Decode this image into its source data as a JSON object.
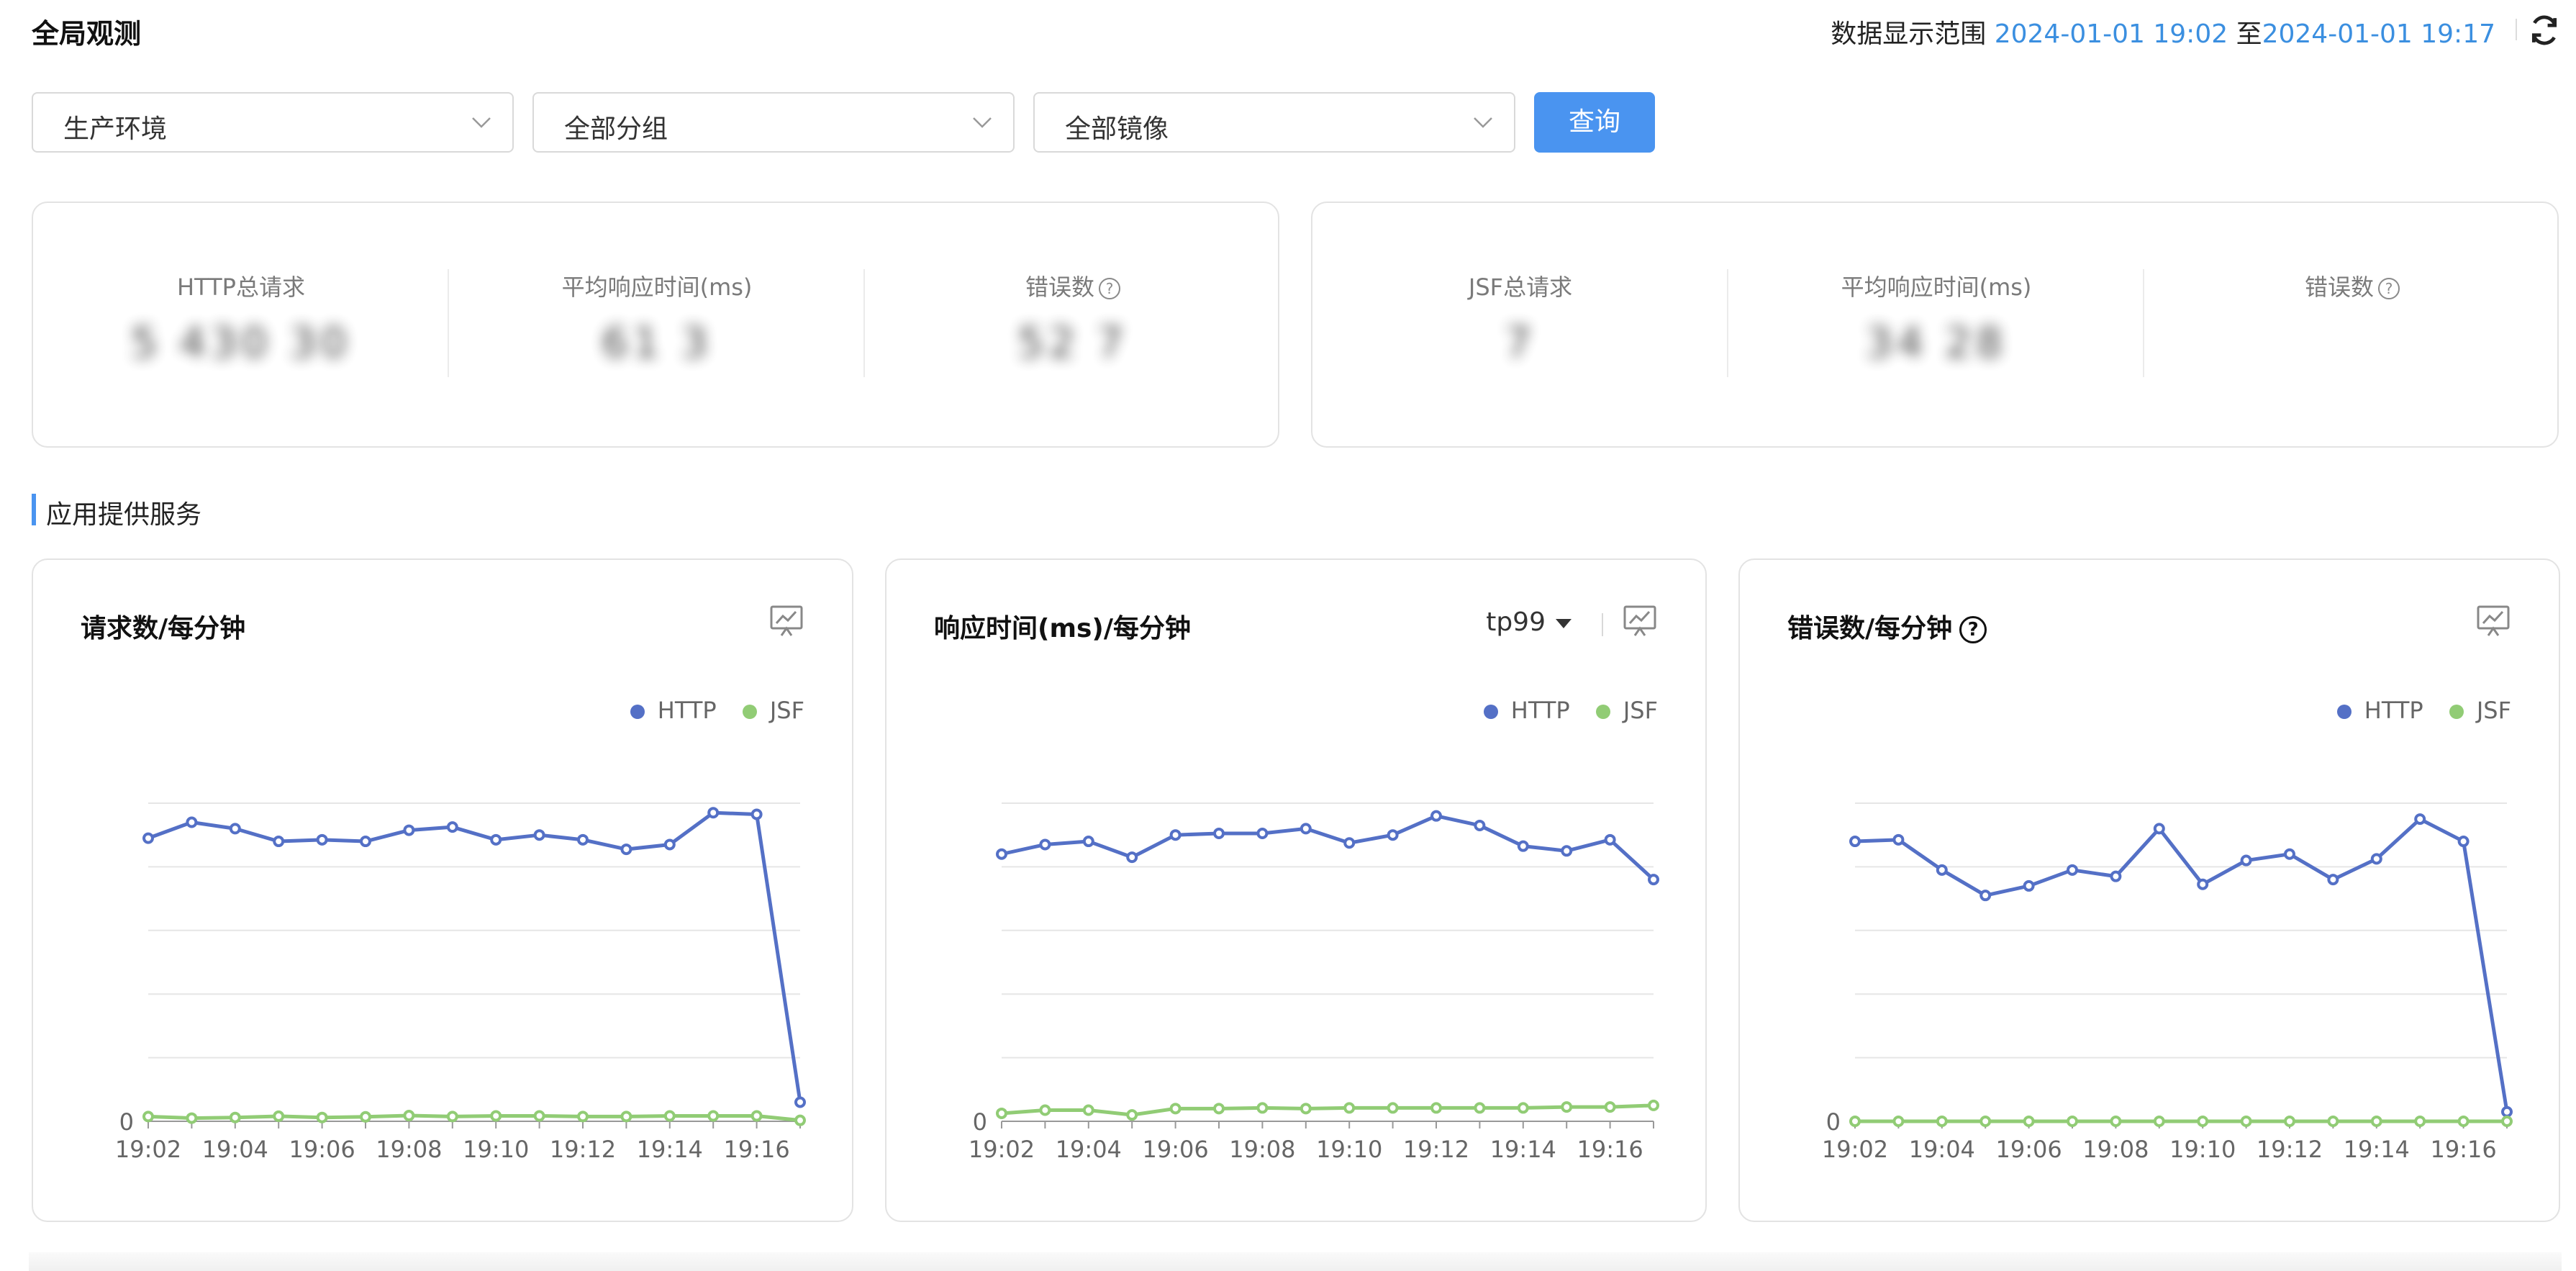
{
  "header": {
    "title": "全局观测",
    "range_label": "数据显示范围",
    "range_start": "2024-01-01 19:02",
    "range_to": "至",
    "range_end": "2024-01-01 19:17"
  },
  "filters": {
    "environment": "生产环境",
    "group": "全部分组",
    "image": "全部镜像",
    "query_label": "查询"
  },
  "summary_http": {
    "items": [
      {
        "label": "HTTP总请求",
        "value": "5 430 30"
      },
      {
        "label": "平均响应时间(ms)",
        "value": "61      3"
      },
      {
        "label": "错误数",
        "value": "52 7"
      }
    ]
  },
  "summary_jsf": {
    "items": [
      {
        "label": "JSF总请求",
        "value": "7   "
      },
      {
        "label": "平均响应时间(ms)",
        "value": "  34 28"
      },
      {
        "label": "错误数",
        "value": "  "
      }
    ]
  },
  "section": {
    "title": "应用提供服务"
  },
  "colors": {
    "http": "#5470c6",
    "jsf": "#91cc75",
    "accent": "#4a94f0"
  },
  "charts": [
    {
      "title": "请求数/每分钟",
      "legend": [
        "HTTP",
        "JSF"
      ],
      "chart_data": {
        "type": "line",
        "x": [
          "19:02",
          "19:03",
          "19:04",
          "19:05",
          "19:06",
          "19:07",
          "19:08",
          "19:09",
          "19:10",
          "19:11",
          "19:12",
          "19:13",
          "19:14",
          "19:15",
          "19:16",
          "19:17"
        ],
        "x_tick_labels": [
          "19:02",
          "19:04",
          "19:06",
          "19:08",
          "19:10",
          "19:12",
          "19:14",
          "19:16"
        ],
        "y_tick_labels": [
          "0"
        ],
        "ylim": [
          0,
          100
        ],
        "series": [
          {
            "name": "HTTP",
            "values": [
              89,
              94,
              92,
              88,
              88.5,
              88,
              91.5,
              92.5,
              88.5,
              90,
              88.5,
              85.5,
              87,
              97,
              96.5,
              6
            ]
          },
          {
            "name": "JSF",
            "values": [
              1.5,
              1,
              1.2,
              1.6,
              1.2,
              1.4,
              1.8,
              1.5,
              1.7,
              1.7,
              1.5,
              1.5,
              1.7,
              1.7,
              1.7,
              0.3
            ]
          }
        ]
      }
    },
    {
      "title": "响应时间(ms)/每分钟",
      "percentile": "tp99",
      "legend": [
        "HTTP",
        "JSF"
      ],
      "chart_data": {
        "type": "line",
        "x": [
          "19:02",
          "19:03",
          "19:04",
          "19:05",
          "19:06",
          "19:07",
          "19:08",
          "19:09",
          "19:10",
          "19:11",
          "19:12",
          "19:13",
          "19:14",
          "19:15",
          "19:16",
          "19:17"
        ],
        "x_tick_labels": [
          "19:02",
          "19:04",
          "19:06",
          "19:08",
          "19:10",
          "19:12",
          "19:14",
          "19:16"
        ],
        "y_tick_labels": [
          "0"
        ],
        "ylim": [
          0,
          100
        ],
        "series": [
          {
            "name": "HTTP",
            "values": [
              84,
              87,
              88,
              83,
              90,
              90.5,
              90.5,
              92,
              87.5,
              90,
              96,
              93,
              86.5,
              85,
              88.5,
              76
            ]
          },
          {
            "name": "JSF",
            "values": [
              2.5,
              3.5,
              3.5,
              2,
              4,
              4,
              4.2,
              4,
              4.2,
              4.2,
              4.2,
              4.2,
              4.2,
              4.5,
              4.5,
              5
            ]
          }
        ]
      }
    },
    {
      "title": "错误数/每分钟",
      "legend": [
        "HTTP",
        "JSF"
      ],
      "chart_data": {
        "type": "line",
        "x": [
          "19:02",
          "19:03",
          "19:04",
          "19:05",
          "19:06",
          "19:07",
          "19:08",
          "19:09",
          "19:10",
          "19:11",
          "19:12",
          "19:13",
          "19:14",
          "19:15",
          "19:16",
          "19:17"
        ],
        "x_tick_labels": [
          "19:02",
          "19:04",
          "19:06",
          "19:08",
          "19:10",
          "19:12",
          "19:14",
          "19:16"
        ],
        "y_tick_labels": [
          "0"
        ],
        "ylim": [
          0,
          100
        ],
        "series": [
          {
            "name": "HTTP",
            "values": [
              88,
              88.5,
              79,
              71,
              74,
              79,
              77,
              92,
              74.5,
              82,
              84,
              76,
              82.5,
              95,
              88,
              3
            ]
          },
          {
            "name": "JSF",
            "values": [
              0,
              0,
              0,
              0,
              0,
              0,
              0,
              0,
              0,
              0,
              0,
              0,
              0,
              0,
              0,
              0
            ]
          }
        ]
      }
    }
  ]
}
